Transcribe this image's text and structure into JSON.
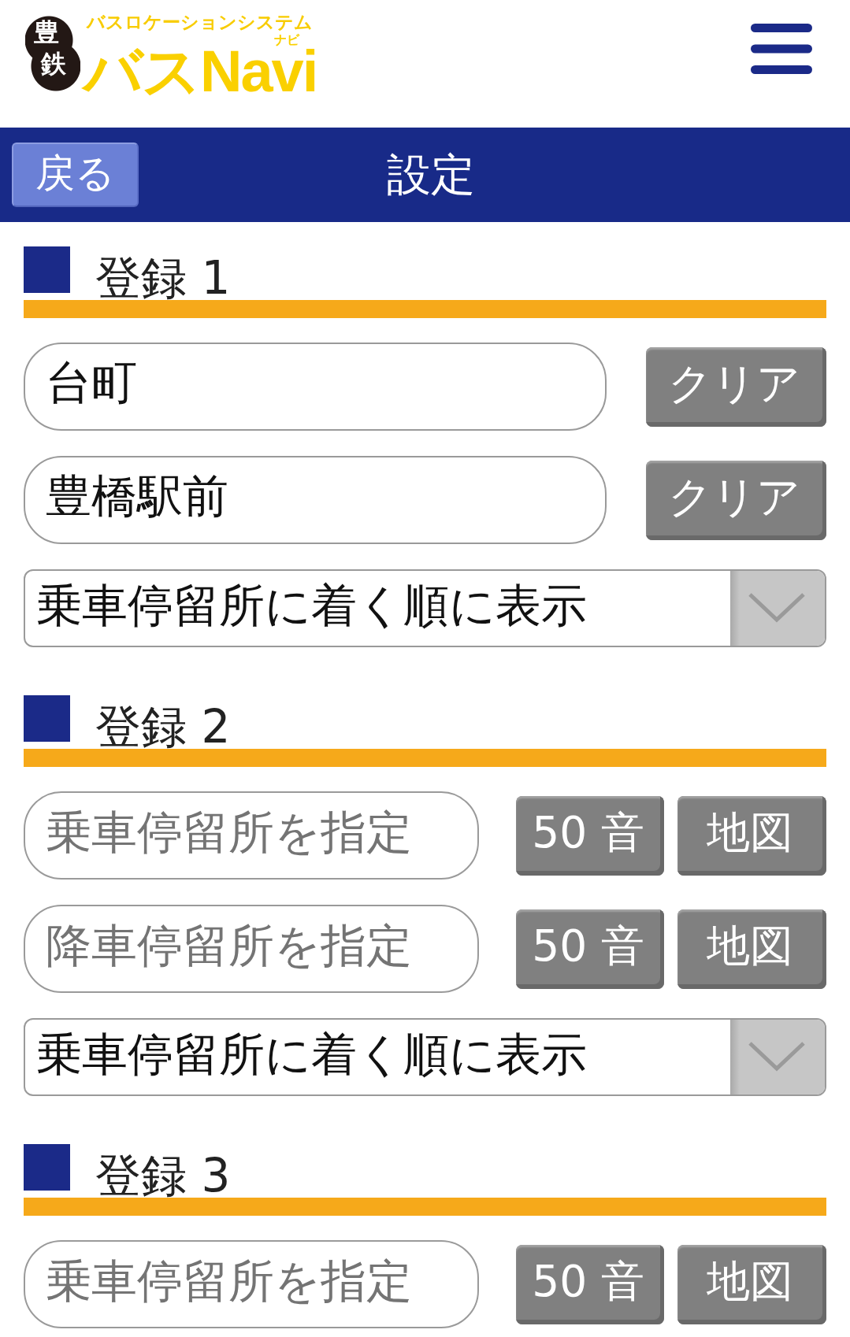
{
  "header": {
    "logo": {
      "badge": [
        "豊",
        "鉄"
      ],
      "tagline": "バスロケーションシステム",
      "name": "バスNavi",
      "ruby": "ナビ"
    }
  },
  "nav": {
    "back_button": "戻る",
    "title": "設定"
  },
  "sections": [
    {
      "title": "登録 1",
      "stops": [
        {
          "value": "台町",
          "clear_button": "クリア"
        },
        {
          "value": "豊橋駅前",
          "clear_button": "クリア"
        }
      ],
      "sort_select": {
        "value": "乗車停留所に着く順に表示"
      }
    },
    {
      "title": "登録 2",
      "stops": [
        {
          "placeholder": "乗車停留所を指定",
          "kana_button": "50 音",
          "map_button": "地図"
        },
        {
          "placeholder": "降車停留所を指定",
          "kana_button": "50 音",
          "map_button": "地図"
        }
      ],
      "sort_select": {
        "value": "乗車停留所に着く順に表示"
      }
    },
    {
      "title": "登録 3",
      "stops": [
        {
          "placeholder": "乗車停留所を指定",
          "kana_button": "50 音",
          "map_button": "地図"
        }
      ]
    }
  ]
}
